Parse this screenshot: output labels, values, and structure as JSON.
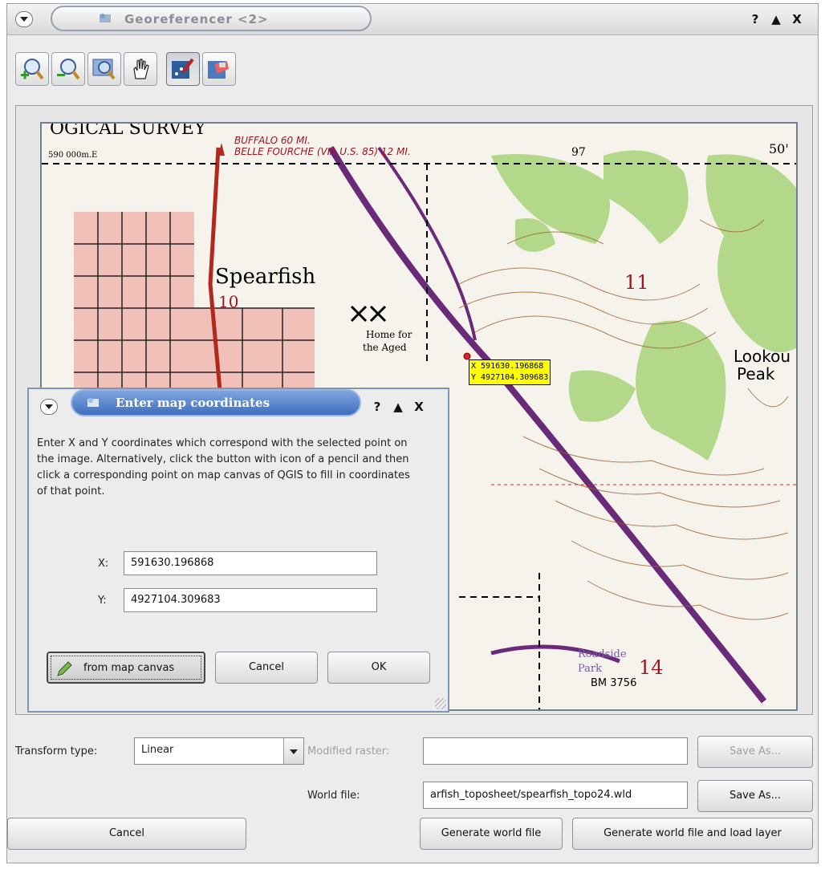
{
  "window": {
    "title": "Georeferencer <2>",
    "controls": [
      "?",
      "▲",
      "X"
    ]
  },
  "toolbar": {
    "icons": [
      "zoom-in-icon",
      "zoom-out-icon",
      "zoom-to-layer-icon",
      "pan-icon",
      "add-point-icon",
      "delete-point-icon"
    ]
  },
  "map": {
    "coord_label_x": "X 591630.196868",
    "coord_label_y": "Y 4927104.309683",
    "texts": {
      "survey": "OGICAL SURVEY",
      "buffalo": "BUFFALO 60 MI.",
      "belle": "BELLE FOURCHE (VIA U.S. 85) 12 MI.",
      "spearfish": "Spearfish",
      "ten": "10",
      "eleven": "11",
      "fourteen": "14",
      "lookout": "Lookou",
      "peak": "Peak",
      "home": "Home for",
      "aged": "the Aged",
      "roadside": "Roadside",
      "park": "Park",
      "bm": "BM 3756",
      "scale": "590 000m.E",
      "ninetyseven": "97",
      "fifty": "50'"
    }
  },
  "dialog": {
    "title": "Enter map coordinates",
    "controls": [
      "?",
      "▲",
      "X"
    ],
    "instructions": "Enter X and Y coordinates which correspond with the selected point on the image. Alternatively, click the button with icon of a pencil and then click a corresponding point on map canvas of QGIS to fill in coordinates of that point.",
    "x_label": "X:",
    "x_value": "591630.196868",
    "y_label": "Y:",
    "y_value": "4927104.309683",
    "from_map_canvas": "from map canvas",
    "cancel": "Cancel",
    "ok": "OK"
  },
  "bottom": {
    "transform_label": "Transform type:",
    "transform_value": "Linear",
    "modified_raster_label": "Modified raster:",
    "modified_raster_value": "",
    "save_as_1": "Save As...",
    "world_file_label": "World file:",
    "world_file_value": "arfish_toposheet/spearfish_topo24.wld",
    "save_as_2": "Save As...",
    "cancel": "Cancel",
    "generate_world_file": "Generate world file",
    "generate_and_load": "Generate world file and load layer"
  }
}
